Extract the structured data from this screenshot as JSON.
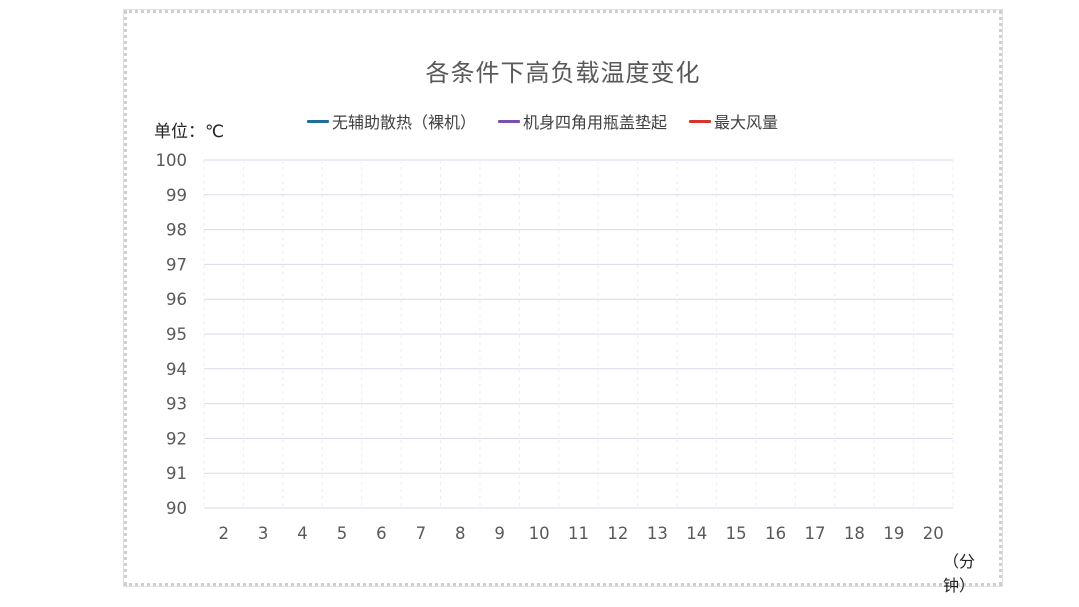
{
  "chart_data": {
    "type": "line",
    "title": "各条件下高负载温度变化",
    "ylabel_unit": "单位：℃",
    "xlabel_unit": "（分钟）",
    "categories": [
      "2",
      "3",
      "4",
      "5",
      "6",
      "7",
      "8",
      "9",
      "10",
      "11",
      "12",
      "13",
      "14",
      "15",
      "16",
      "17",
      "18",
      "19",
      "20"
    ],
    "ylim": [
      90,
      100
    ],
    "yticks": [
      "90",
      "91",
      "92",
      "93",
      "94",
      "95",
      "96",
      "97",
      "98",
      "99",
      "100"
    ],
    "grid": true,
    "legend_position": "top",
    "series": [
      {
        "name": "无辅助散热（裸机）",
        "color": "#1f6f98",
        "values": []
      },
      {
        "name": "机身四角用瓶盖垫起",
        "color": "#7b4fb0",
        "values": []
      },
      {
        "name": "最大风量",
        "color": "#d9342b",
        "values": []
      }
    ]
  }
}
